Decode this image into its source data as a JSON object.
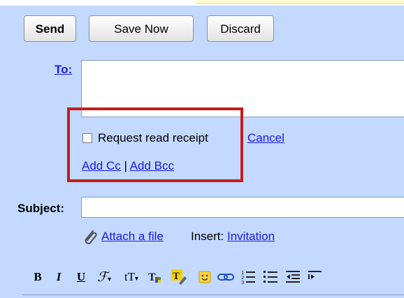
{
  "toolbar": {
    "send_label": "Send",
    "save_label": "Save Now",
    "discard_label": "Discard"
  },
  "to": {
    "label": "To:",
    "value": ""
  },
  "options": {
    "read_receipt_label": "Request read receipt",
    "read_receipt_checked": false,
    "cancel_label": "Cancel",
    "add_cc_label": "Add Cc",
    "separator": "|",
    "add_bcc_label": "Add Bcc"
  },
  "subject": {
    "label": "Subject:",
    "value": ""
  },
  "attach": {
    "attach_label": "Attach a file",
    "insert_label": "Insert:",
    "invitation_label": "Invitation"
  },
  "format": {
    "bold": "B",
    "italic": "I",
    "underline": "U",
    "font": "ℱ",
    "size": "tT",
    "colors": {
      "highlight": "#f6d200",
      "emoji": "#ffd23f",
      "text_red": "#e02020",
      "text_green": "#1ea51e",
      "text_blue": "#2050e0"
    }
  }
}
